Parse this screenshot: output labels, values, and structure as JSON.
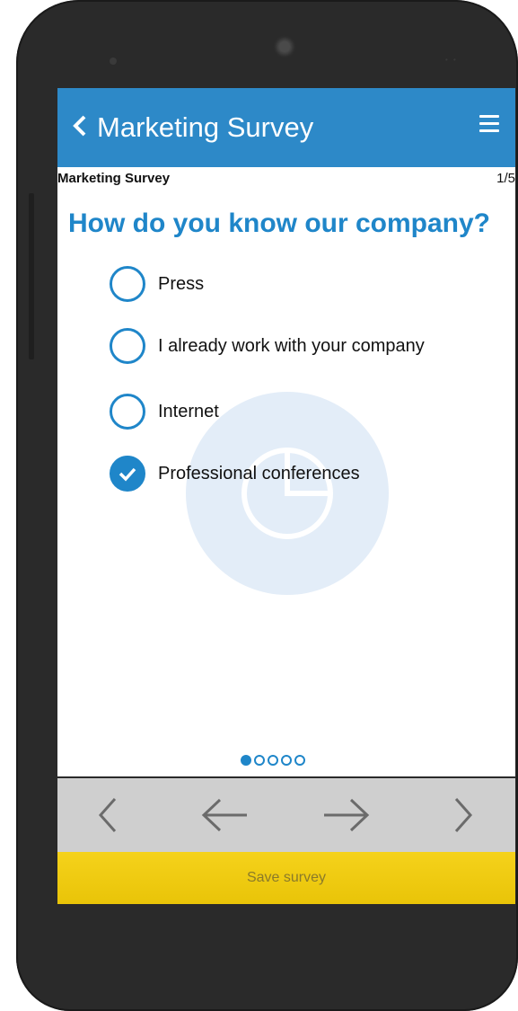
{
  "app_bar": {
    "title": "Marketing Survey",
    "back_icon": "chevron-left-icon",
    "menu_icon": "hamburger-menu-icon",
    "color": "#2d89c8"
  },
  "survey": {
    "name": "Marketing Survey",
    "page_indicator": "1/5",
    "question": "How do you know our company?",
    "options": [
      {
        "label": "Press",
        "checked": false
      },
      {
        "label": "I already work with your company",
        "checked": false
      },
      {
        "label": "Internet",
        "checked": false
      },
      {
        "label": "Professional conferences",
        "checked": true
      }
    ],
    "accent_color": "#1f86c9",
    "pagination": {
      "total": 5,
      "current": 1
    }
  },
  "navigation": {
    "first_icon": "chevron-left-icon",
    "prev_icon": "arrow-left-icon",
    "next_icon": "arrow-right-icon",
    "last_icon": "chevron-right-icon"
  },
  "save": {
    "label": "Save survey",
    "color": "#f2cd15"
  }
}
